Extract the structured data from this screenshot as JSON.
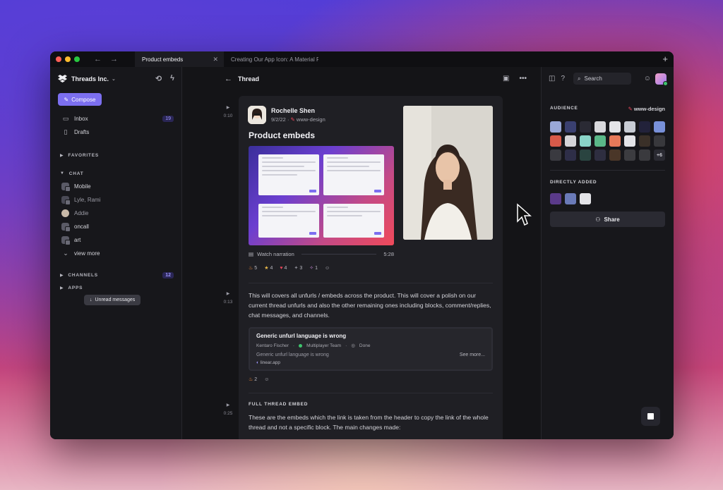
{
  "tabs": [
    {
      "label": "Product embeds",
      "active": true
    },
    {
      "label": "Creating Our App Icon: A Material Re",
      "active": false
    }
  ],
  "sidebar": {
    "workspace": "Threads Inc.",
    "compose": "Compose",
    "inbox": {
      "label": "Inbox",
      "count": "19"
    },
    "drafts": "Drafts",
    "favorites": "FAVORITES",
    "chat": "CHAT",
    "chat_items": [
      "Mobile",
      "Lyle, Rami",
      "Addie",
      "oncall",
      "art"
    ],
    "view_more": "view more",
    "channels": {
      "label": "CHANNELS",
      "count": "12"
    },
    "apps": "APPS",
    "tooltip": "Unread messages"
  },
  "main": {
    "title": "Thread",
    "timestamps": [
      "0:10",
      "0:13",
      "0:25"
    ],
    "post": {
      "author": "Rochelle Shen",
      "date": "9/2/22",
      "channel": "www-design",
      "title": "Product embeds",
      "narration": "Watch narration",
      "duration": "5:28",
      "reactions": [
        "5",
        "4",
        "4",
        "3",
        "1"
      ]
    },
    "paragraph1": "This will covers all unfurls / embeds across the product. This will cover a polish on our current thread unfurls and also the other remaining ones including blocks, comment/replies, chat messages, and channels.",
    "unfurl": {
      "title": "Generic unfurl language is wrong",
      "assignee": "Kentaro Fischer",
      "project": "Multiplayer Team",
      "status": "Done",
      "desc": "Generic unfurl language is wrong",
      "link": "linear.app",
      "see_more": "See more..."
    },
    "reactions2": [
      "2"
    ],
    "full_embed_heading": "FULL THREAD EMBED",
    "paragraph2": "These are the embeds which the link is taken from the header to copy the link of the whole thread and not a specific block. The main changes made:"
  },
  "right": {
    "search": "Search",
    "audience": "AUDIENCE",
    "audience_tag": "www-design",
    "more_count": "+6",
    "directly_added": "DIRECTLY ADDED",
    "share": "Share"
  },
  "colors": {
    "accent": "#7c6ff0",
    "brand_pen": "#e8465a",
    "status_green": "#3ec46d"
  }
}
